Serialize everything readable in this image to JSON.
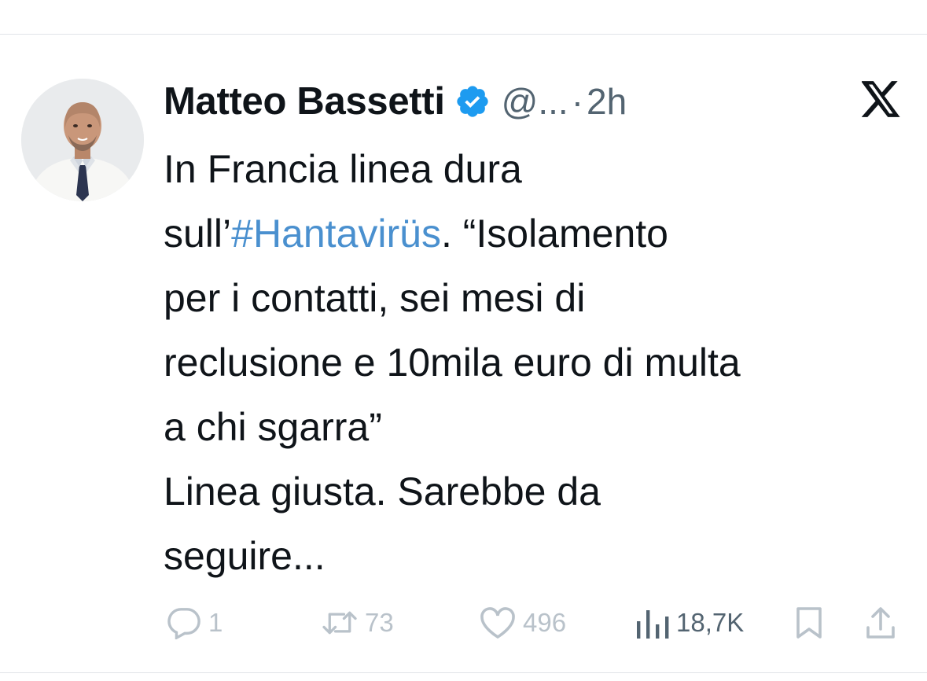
{
  "tweet": {
    "author_name": "Matteo Bassetti",
    "handle": "@...",
    "separator": "·",
    "time": "2h",
    "text_line1": "In Francia linea dura",
    "text_prefix": "sull’",
    "hashtag": "#Hantavirüs",
    "text_line2_rest": ". “Isolamento",
    "text_line3": "per i contatti, sei mesi di",
    "text_line4": "reclusione e 10mila euro di multa",
    "text_line5": "a chi sgarra”",
    "text_line6": "Linea giusta. Sarebbe da",
    "text_line7": "seguire..."
  },
  "actions": {
    "replies": "1",
    "reposts": "73",
    "likes": "496",
    "views": "18,7K"
  },
  "icons": {
    "verified": "verified-badge-icon",
    "platform": "x-logo-icon",
    "reply": "reply-icon",
    "repost": "repost-icon",
    "like": "heart-icon",
    "views": "views-chart-icon",
    "bookmark": "bookmark-icon",
    "share": "share-icon"
  },
  "colors": {
    "accent": "#1d9bf0",
    "hashtag": "#4a90cf",
    "muted": "#536471",
    "faded_action": "#b9c2ca"
  }
}
